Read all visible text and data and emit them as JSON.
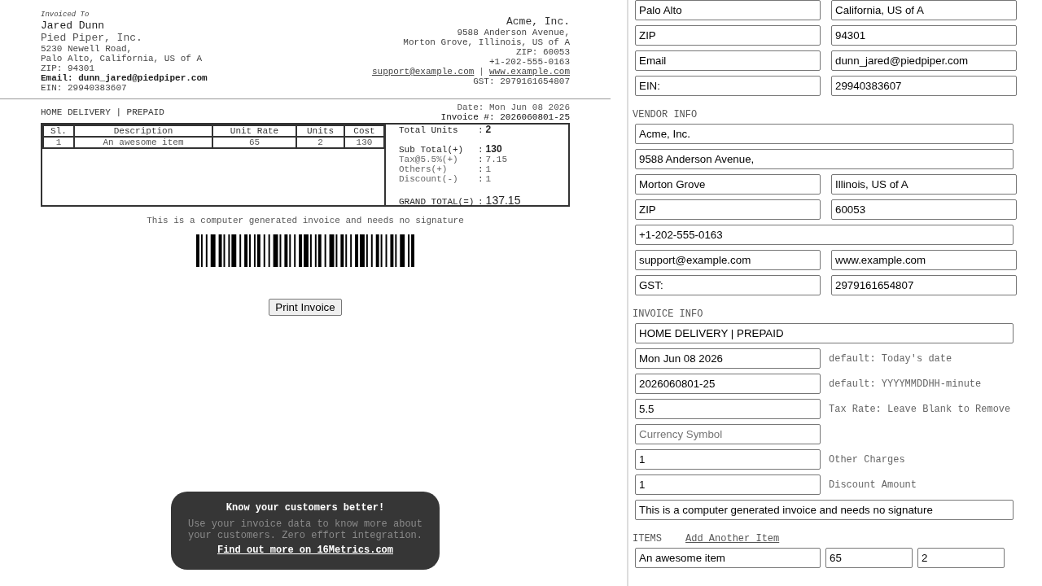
{
  "invoice": {
    "customer": {
      "caption": "Invoiced To",
      "name": "Jared Dunn",
      "company": "Pied Piper, Inc.",
      "lines": [
        {
          "kind": "plain",
          "text": "5230 Newell Road,"
        },
        {
          "kind": "plain",
          "text": "Palo Alto, California, US of A"
        },
        {
          "kind": "plain",
          "text": "ZIP: 94301"
        },
        {
          "kind": "strong",
          "text": "Email: dunn_jared@piedpiper.com"
        },
        {
          "kind": "plain",
          "text": "EIN: 29940383607"
        }
      ]
    },
    "vendor": {
      "name": "Acme, Inc.",
      "lines": [
        "9588 Anderson Avenue,",
        "Morton Grove, Illinois, US of A",
        "ZIP: 60053",
        "+1-202-555-0163"
      ],
      "links": [
        "support@example.com",
        "www.example.com"
      ],
      "link_separator": "|",
      "gst": "GST: 2979161654807"
    },
    "delivery": "HOME DELIVERY | PREPAID",
    "date": "Date: Mon Jun 08 2026",
    "invoice_number": "Invoice #: 2026060801-25",
    "table": {
      "columns": [
        "Sl.",
        "Description",
        "Unit Rate",
        "Units",
        "Cost"
      ],
      "rows": [
        [
          "1",
          "An awesome item",
          "65",
          "2",
          "130"
        ]
      ]
    },
    "summary": [
      {
        "kind": "count",
        "label": "Total Units",
        "sep": ":",
        "value": "2"
      },
      {
        "kind": "total",
        "label": "Sub Total(+)",
        "sep": ":",
        "value": "130"
      },
      {
        "kind": "charge",
        "label": "Tax@5.5%(+)",
        "sep": ":",
        "value": "7.15"
      },
      {
        "kind": "charge",
        "label": "Others(+)",
        "sep": ":",
        "value": "1"
      },
      {
        "kind": "charge",
        "label": "Discount(-)",
        "sep": ":",
        "value": "1"
      },
      {
        "kind": "grand",
        "label": "GRAND TOTAL(=)",
        "sep": ":",
        "value": "137.15"
      }
    ],
    "note": "This is a computer generated invoice and needs no signature",
    "print_button": "Print Invoice"
  },
  "promo": {
    "title": "Know your customers better!",
    "body": "Use your invoice data to know more about your customers. Zero effort integration.",
    "link": "Find out more on 16Metrics.com"
  },
  "form": {
    "customer_rows": [
      [
        {
          "value": "Palo Alto"
        },
        {
          "value": "California, US of A"
        }
      ],
      [
        {
          "value": "ZIP"
        },
        {
          "value": "94301"
        }
      ],
      [
        {
          "value": "Email"
        },
        {
          "value": "dunn_jared@piedpiper.com"
        }
      ],
      [
        {
          "value": "EIN:"
        },
        {
          "value": "29940383607"
        }
      ]
    ],
    "vendor": {
      "heading": "VENDOR INFO",
      "rows": [
        [
          {
            "value": "Acme, Inc."
          }
        ],
        [
          {
            "value": "9588 Anderson Avenue,"
          }
        ],
        [
          {
            "value": "Morton Grove"
          },
          {
            "value": "Illinois, US of A"
          }
        ],
        [
          {
            "value": "ZIP"
          },
          {
            "value": "60053"
          }
        ],
        [
          {
            "value": "+1-202-555-0163"
          }
        ],
        [
          {
            "value": "support@example.com"
          },
          {
            "value": "www.example.com"
          }
        ],
        [
          {
            "value": "GST:"
          },
          {
            "value": "2979161654807"
          }
        ]
      ]
    },
    "invoice": {
      "heading": "INVOICE INFO",
      "rows": [
        {
          "kind": "wide",
          "value": "HOME DELIVERY | PREPAID"
        },
        {
          "kind": "narrow",
          "value": "Mon Jun 08 2026",
          "hint": "default: Today's date"
        },
        {
          "kind": "narrow",
          "value": "2026060801-25",
          "hint": "default: YYYYMMDDHH-minute"
        },
        {
          "kind": "narrow",
          "value": "5.5",
          "hint": "Tax Rate: Leave Blank to Remove"
        },
        {
          "kind": "narrow",
          "placeholder": "Currency Symbol"
        },
        {
          "kind": "narrow",
          "value": "1",
          "hint": "Other Charges"
        },
        {
          "kind": "narrow",
          "value": "1",
          "hint": "Discount Amount"
        },
        {
          "kind": "wide",
          "value": "This is a computer generated invoice and needs no signature"
        }
      ]
    },
    "items": {
      "heading": "ITEMS",
      "add_link": "Add Another Item",
      "rows": [
        {
          "description": "An awesome item",
          "rate": "65",
          "units": "2"
        }
      ]
    }
  }
}
